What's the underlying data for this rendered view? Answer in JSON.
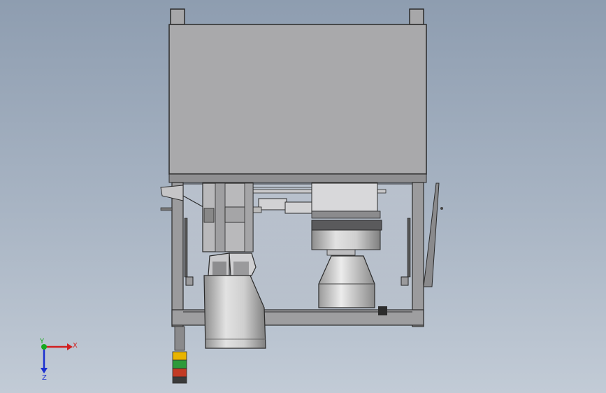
{
  "viewport": {
    "background_top": "#8e9db0",
    "background_bottom": "#c2cbd6"
  },
  "model": {
    "housing_color": "#a9a9ab",
    "frame_color": "#7b7b7d",
    "glass_color": "#bcc3cc",
    "edge_color": "#2b2b2b",
    "cylinder_light": "#e2e2e2",
    "cylinder_dark": "#8d8d8d"
  },
  "beacon": {
    "colors": [
      "#e9b400",
      "#2d9a3a",
      "#c23a24"
    ]
  },
  "triad": {
    "x_label": "X",
    "y_label": "Y",
    "z_label": "Z",
    "x_color": "#d11f1f",
    "y_color": "#18a91f",
    "z_color": "#1a2fd0"
  }
}
